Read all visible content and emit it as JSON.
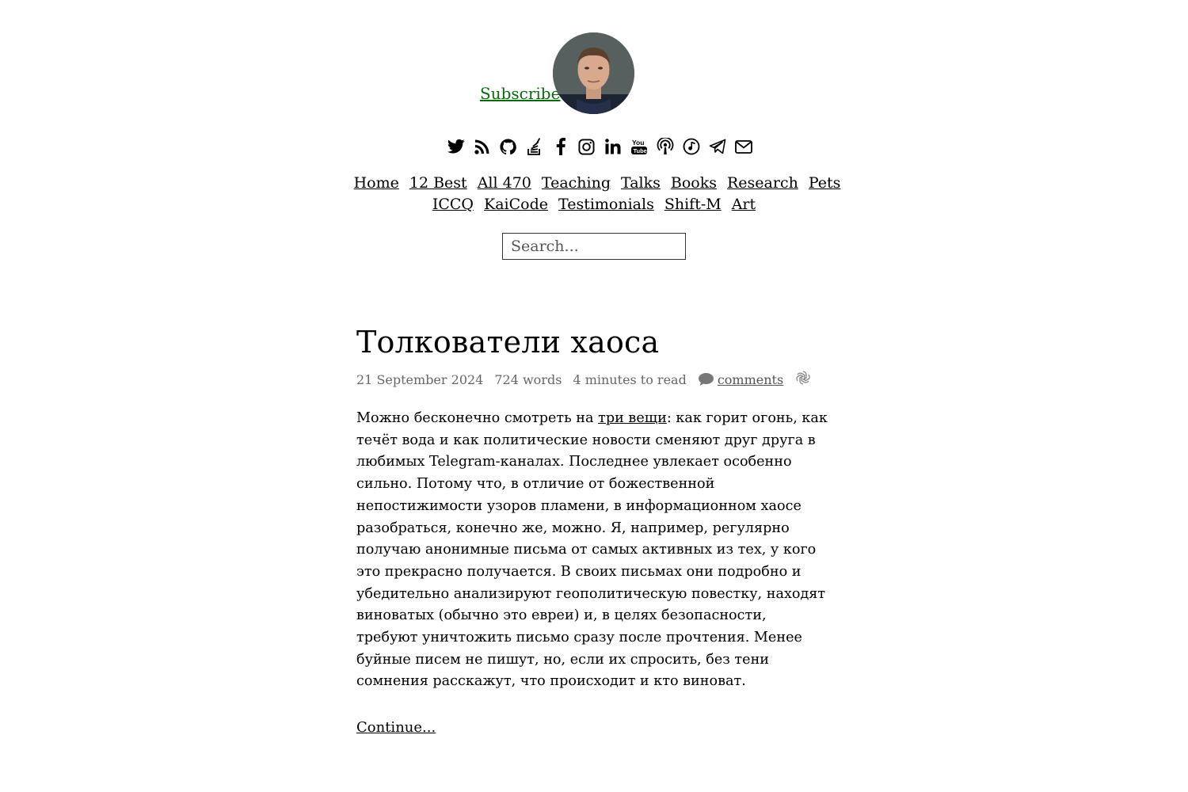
{
  "header": {
    "subscribe_label": "Subscribe",
    "accent_color": "#0a6b0a",
    "avatar_alt": "avatar",
    "social_icons": [
      "twitter-icon",
      "rss-icon",
      "github-icon",
      "stackoverflow-icon",
      "facebook-icon",
      "instagram-icon",
      "linkedin-icon",
      "youtube-icon",
      "podcast-icon",
      "music-icon",
      "telegram-icon",
      "email-icon"
    ]
  },
  "nav": {
    "row1": [
      "Home",
      "12 Best",
      "All 470",
      "Teaching",
      "Talks",
      "Books",
      "Research",
      "Pets"
    ],
    "row2": [
      "ICCQ",
      "KaiCode",
      "Testimonials",
      "Shift-M",
      "Art"
    ]
  },
  "search": {
    "placeholder": "Search..."
  },
  "post": {
    "title": "Толкователи хаоса",
    "date": "21 September 2024",
    "words": "724 words",
    "read_time": "4 minutes to read",
    "comments_label": "comments",
    "body_before_link": "Можно бесконечно смотреть на ",
    "body_link": "три вещи",
    "body_after_link": ": как горит огонь, как течёт вода и как политические новости сменяют друг друга в любимых Telegram-каналах. Последнее увлекает особенно сильно. Потому что, в отличие от божественной непостижимости узоров пламени, в информационном хаосе разобраться, конечно же, можно. Я, например, регулярно получаю анонимные письма от самых активных из тех, у кого это прекрасно получается. В своих письмах они подробно и убедительно анализируют геополитическую повестку, находят виноватых (обычно это евреи) и, в целях безопасности, требуют уничтожить письмо сразу после прочтения. Менее буйные писем не пишут, но, если их спросить, без тени сомнения расскажут, что происходит и кто виноват.",
    "continue_label": "Continue..."
  }
}
